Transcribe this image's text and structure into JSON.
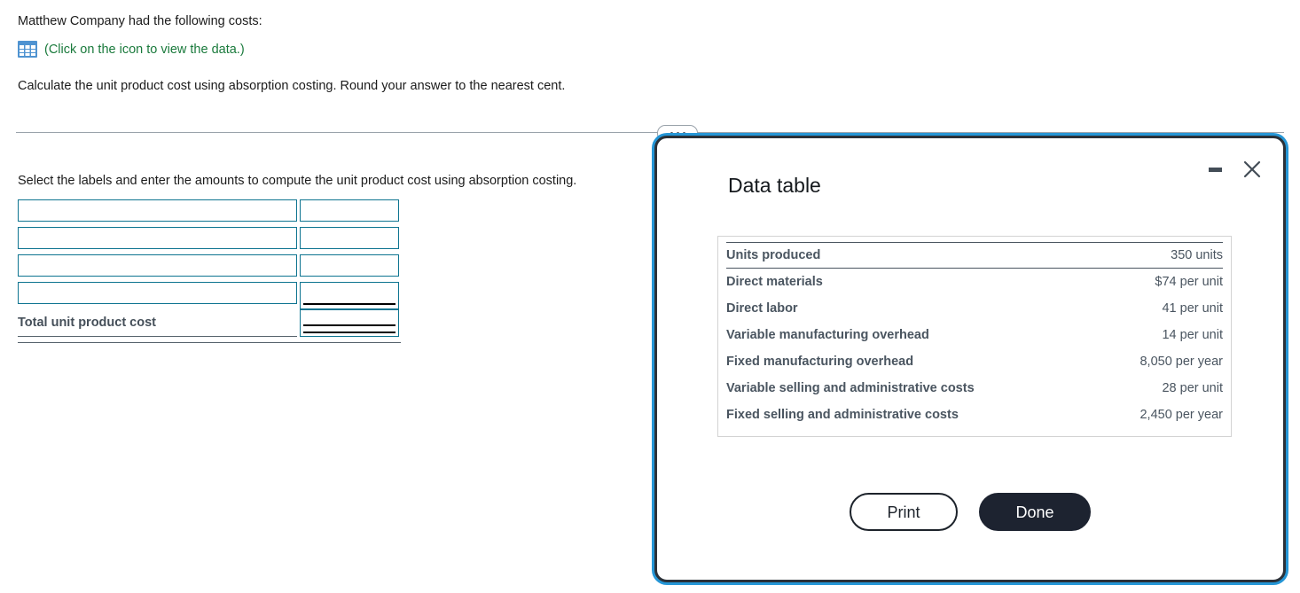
{
  "question": {
    "intro": "Matthew Company had the following costs:",
    "data_link_icon": "table-grid-icon",
    "data_link_text": "(Click on the icon to view the data.)",
    "instruction": "Calculate the unit product cost using absorption costing. Round your answer to the nearest cent."
  },
  "divider": {
    "handle_icon": "ellipsis-handle-icon"
  },
  "worksheet": {
    "instruction": "Select the labels and enter the amounts to compute the unit product cost using absorption costing.",
    "rows": [
      {
        "label_value": "",
        "label_placeholder": "",
        "amount_value": "",
        "amount_placeholder": "",
        "rule": "none"
      },
      {
        "label_value": "",
        "label_placeholder": "",
        "amount_value": "",
        "amount_placeholder": "",
        "rule": "none"
      },
      {
        "label_value": "",
        "label_placeholder": "",
        "amount_value": "",
        "amount_placeholder": "",
        "rule": "none"
      },
      {
        "label_value": "",
        "label_placeholder": "",
        "amount_value": "",
        "amount_placeholder": "",
        "rule": "single"
      }
    ],
    "total_label": "Total unit product cost",
    "total_amount_value": "",
    "total_amount_placeholder": "",
    "total_rule": "double"
  },
  "dialog": {
    "title": "Data table",
    "minimize_icon": "minimize-icon",
    "close_icon": "close-icon",
    "table": {
      "rows": [
        {
          "label": "Units produced",
          "value": "350 units",
          "head": true
        },
        {
          "label": "Direct materials",
          "value": "$74 per unit",
          "head": false
        },
        {
          "label": "Direct labor",
          "value": "41 per unit",
          "head": false
        },
        {
          "label": "Variable manufacturing overhead",
          "value": "14 per unit",
          "head": false
        },
        {
          "label": "Fixed manufacturing overhead",
          "value": "8,050 per year",
          "head": false
        },
        {
          "label": "Variable selling and administrative costs",
          "value": "28 per unit",
          "head": false
        },
        {
          "label": "Fixed selling and administrative costs",
          "value": "2,450 per year",
          "head": false
        }
      ]
    },
    "print_label": "Print",
    "done_label": "Done"
  },
  "colors": {
    "link_green": "#1a7a3c",
    "input_border_teal": "#0d7490",
    "dialog_focus_blue": "#2596d6",
    "dialog_border_dark": "#2b3138",
    "done_button_bg": "#1d2330",
    "table_text": "#4a5560"
  }
}
